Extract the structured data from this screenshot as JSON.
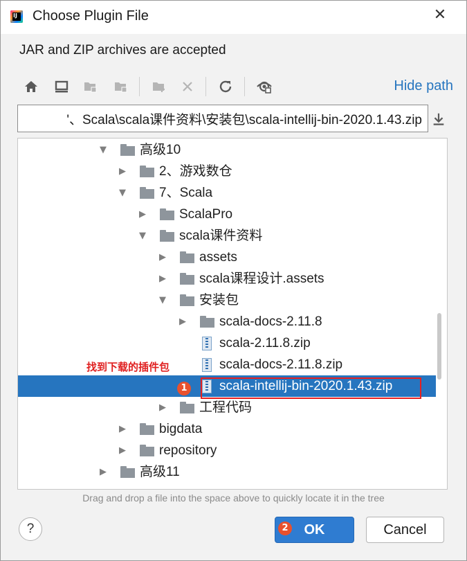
{
  "window": {
    "title": "Choose Plugin File",
    "app_icon_text": "IJ",
    "close_glyph": "✕"
  },
  "subtitle": "JAR and ZIP archives are accepted",
  "toolbar": {
    "icons": [
      "home-icon",
      "desktop-icon",
      "project-icon",
      "module-icon",
      "new-folder-icon",
      "delete-icon",
      "refresh-icon",
      "show-hidden-icon"
    ],
    "hide_path_label": "Hide path"
  },
  "path": {
    "value": "'、Scala\\scala课件资料\\安装包\\scala-intellij-bin-2020.1.43.zip"
  },
  "tree": {
    "items": [
      {
        "label": "高级10",
        "type": "folder",
        "expanded": true
      },
      {
        "label": "2、游戏数仓",
        "type": "folder",
        "expanded": false
      },
      {
        "label": "7、Scala",
        "type": "folder",
        "expanded": true
      },
      {
        "label": "ScalaPro",
        "type": "folder",
        "expanded": false
      },
      {
        "label": "scala课件资料",
        "type": "folder",
        "expanded": true
      },
      {
        "label": "assets",
        "type": "folder",
        "expanded": false
      },
      {
        "label": "scala课程设计.assets",
        "type": "folder",
        "expanded": false
      },
      {
        "label": "安装包",
        "type": "folder",
        "expanded": true
      },
      {
        "label": "scala-docs-2.11.8",
        "type": "folder",
        "expanded": false
      },
      {
        "label": "scala-2.11.8.zip",
        "type": "zip"
      },
      {
        "label": "scala-docs-2.11.8.zip",
        "type": "zip"
      },
      {
        "label": "scala-intellij-bin-2020.1.43.zip",
        "type": "zip",
        "selected": true
      },
      {
        "label": "工程代码",
        "type": "folder",
        "expanded": false
      },
      {
        "label": "bigdata",
        "type": "folder",
        "expanded": false
      },
      {
        "label": "repository",
        "type": "folder",
        "expanded": false
      },
      {
        "label": "高级11",
        "type": "folder",
        "expanded": false
      }
    ]
  },
  "annotation": {
    "text": "找到下载的插件包",
    "step1": "1",
    "step2": "2",
    "color": "#e02020"
  },
  "hint": "Drag and drop a file into the space above to quickly locate it in the tree",
  "buttons": {
    "help": "?",
    "ok": "OK",
    "cancel": "Cancel"
  },
  "colors": {
    "accent": "#2675bf",
    "primary_button": "#2f7cd1",
    "annotation_badge": "#e8512e"
  }
}
